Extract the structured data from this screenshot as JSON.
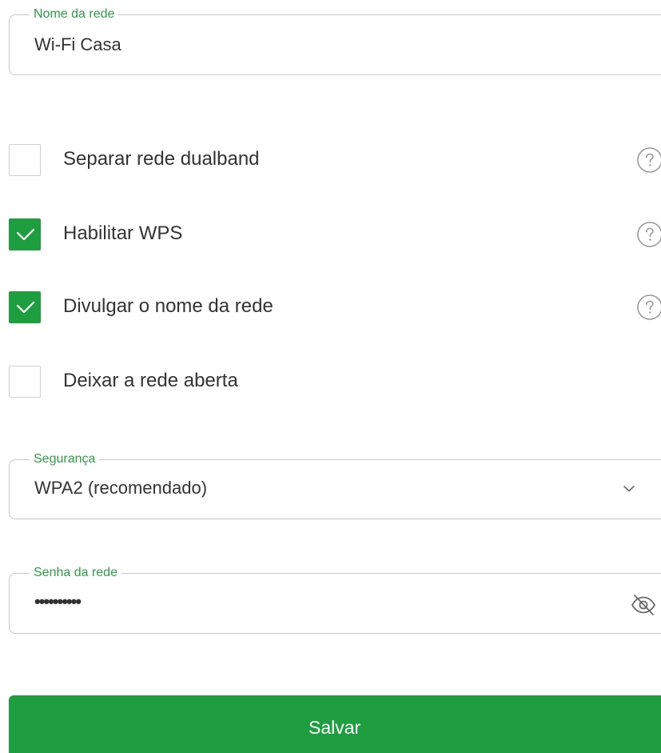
{
  "colors": {
    "accent": "#1e9e3e",
    "legend_text": "#2a9f45",
    "border": "#c8c8c8",
    "text": "#333333"
  },
  "network_name": {
    "label": "Nome da rede",
    "value": "Wi-Fi Casa"
  },
  "options": [
    {
      "label": "Separar rede dualband",
      "checked": false,
      "has_help": true,
      "help_icon": "question-circle-icon"
    },
    {
      "label": "Habilitar WPS",
      "checked": true,
      "has_help": true,
      "help_icon": "question-circle-icon"
    },
    {
      "label": "Divulgar o nome da rede",
      "checked": true,
      "has_help": true,
      "help_icon": "question-circle-icon"
    },
    {
      "label": "Deixar a rede aberta",
      "checked": false,
      "has_help": false
    }
  ],
  "security": {
    "label": "Segurança",
    "selected": "WPA2 (recomendado)",
    "icon": "chevron-down-icon"
  },
  "password": {
    "label": "Senha da rede",
    "masked_value": "••••••••••",
    "toggle_icon": "eye-off-icon"
  },
  "save_button": {
    "label": "Salvar"
  }
}
